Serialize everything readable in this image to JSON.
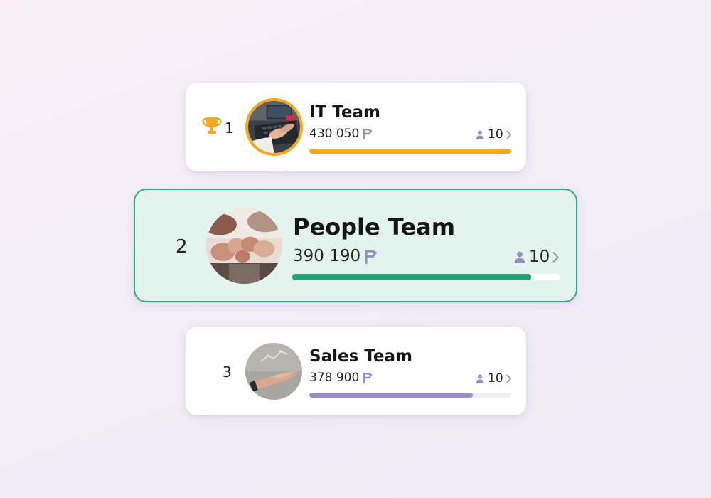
{
  "teams": [
    {
      "rank": "1",
      "name": "IT Team",
      "score": "430 050",
      "members": "10",
      "progress": 1.0,
      "color": "#f6a81f",
      "winner": true,
      "icons": {
        "rank": "trophy-icon",
        "score": "flag-icon",
        "members": "person-icon",
        "more": "chevron-right-icon"
      }
    },
    {
      "rank": "2",
      "name": "People Team",
      "score": "390 190",
      "members": "10",
      "progress": 0.89,
      "color": "#22a57a",
      "highlighted": true,
      "icons": {
        "score": "flag-icon",
        "members": "person-icon",
        "more": "chevron-right-icon"
      }
    },
    {
      "rank": "3",
      "name": "Sales Team",
      "score": "378 900",
      "members": "10",
      "progress": 0.81,
      "color": "#9a8cc4",
      "icons": {
        "score": "flag-icon",
        "members": "person-icon",
        "more": "chevron-right-icon"
      }
    }
  ],
  "colors": {
    "icon_purple": "#9a8cc4",
    "highlight_bg": "#e3f3ee",
    "highlight_border": "#3aa784",
    "trophy": "#f6a81f"
  }
}
